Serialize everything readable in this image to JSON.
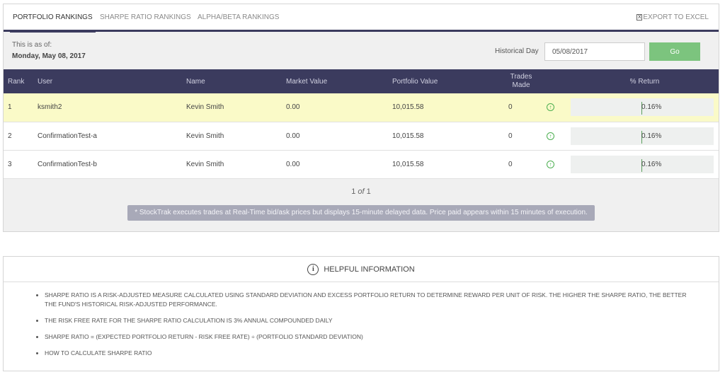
{
  "tabs": [
    {
      "label": "PORTFOLIO RANKINGS"
    },
    {
      "label": "SHARPE RATIO RANKINGS"
    },
    {
      "label": "ALPHA/BETA RANKINGS"
    }
  ],
  "export_label": "EXPORT TO EXCEL",
  "as_of": {
    "label": "This is as of:",
    "date": "Monday, May 08, 2017"
  },
  "historical": {
    "label": "Historical Day",
    "value": "05/08/2017",
    "go_label": "Go"
  },
  "table": {
    "headers": {
      "rank": "Rank",
      "user": "User",
      "name": "Name",
      "market_value": "Market Value",
      "portfolio_value": "Portfolio Value",
      "trades_made": "Trades Made",
      "return": "% Return"
    },
    "rows": [
      {
        "rank": "1",
        "user": "ksmith2",
        "name": "Kevin Smith",
        "market_value": "0.00",
        "portfolio_value": "10,015.58",
        "trades_made": "0",
        "return": "0.16%"
      },
      {
        "rank": "2",
        "user": "ConfirmationTest-a",
        "name": "Kevin Smith",
        "market_value": "0.00",
        "portfolio_value": "10,015.58",
        "trades_made": "0",
        "return": "0.16%"
      },
      {
        "rank": "3",
        "user": "ConfirmationTest-b",
        "name": "Kevin Smith",
        "market_value": "0.00",
        "portfolio_value": "10,015.58",
        "trades_made": "0",
        "return": "0.16%"
      }
    ]
  },
  "pager": {
    "current": "1",
    "of": "of",
    "total": "1"
  },
  "note": "* StockTrak executes trades at Real-Time bid/ask prices but displays 15-minute delayed data. Price paid appears within 15 minutes of execution.",
  "info": {
    "title": "HELPFUL INFORMATION",
    "items": [
      "SHARPE RATIO IS A RISK-ADJUSTED MEASURE CALCULATED USING STANDARD DEVIATION AND EXCESS PORTFOLIO RETURN TO DETERMINE REWARD PER UNIT OF RISK. THE HIGHER THE SHARPE RATIO, THE BETTER THE FUND'S HISTORICAL RISK-ADJUSTED PERFORMANCE.",
      "THE RISK FREE RATE FOR THE SHARPE RATIO CALCULATION IS 3% ANNUAL COMPOUNDED DAILY",
      "SHARPE RATIO = (EXPECTED PORTFOLIO RETURN - RISK FREE RATE) ÷ (PORTFOLIO STANDARD DEVIATION)",
      "HOW TO CALCULATE SHARPE RATIO"
    ]
  },
  "colors": {
    "header_bg": "#3b3b5e",
    "go_button": "#7cc47e",
    "highlight_row": "#fafac8",
    "up_icon": "#4caf50"
  },
  "icons": {
    "export": "excel-icon",
    "trend": "arrow-up-circle-icon",
    "info": "info-circle-icon"
  }
}
